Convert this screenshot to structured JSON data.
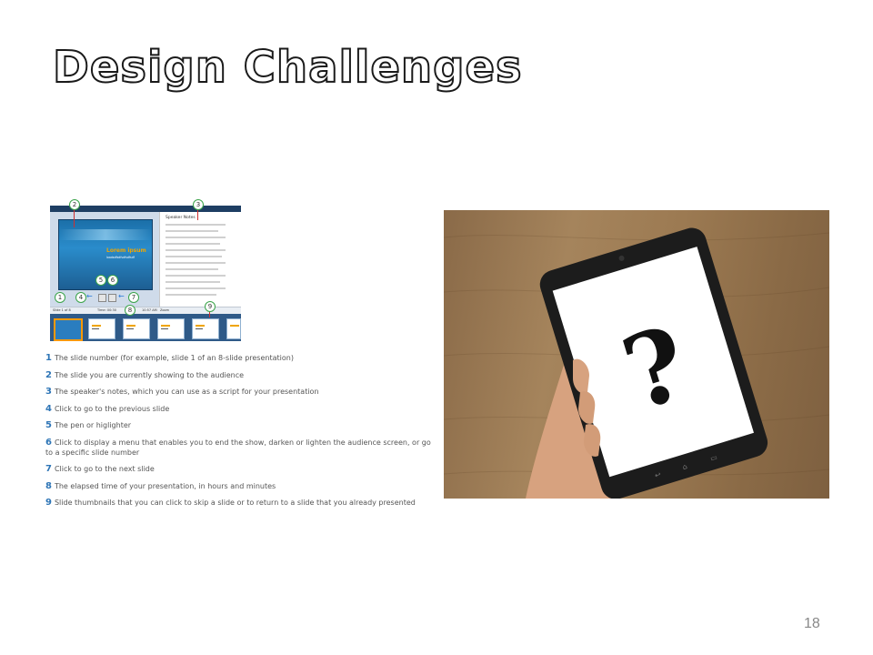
{
  "slide": {
    "title": "Design Challenges",
    "page_number": "18"
  },
  "presenter_view": {
    "lorem_title": "Lorem ipsum",
    "lorem_subtitle": "loadsdfsdfsdfsdfsdf",
    "speaker_notes_label": "Speaker Notes",
    "status_slide": "Slide 1 of 8",
    "status_time": "Time: 00:30",
    "status_clock": "10:57 AM",
    "status_zoom": "Zoom",
    "callouts": [
      "1",
      "2",
      "3",
      "4",
      "5",
      "6",
      "7",
      "8",
      "9"
    ]
  },
  "legend": [
    {
      "num": "1",
      "text": "The slide number (for example, slide 1 of an 8-slide presentation)"
    },
    {
      "num": "2",
      "text": "The slide you are currently showing to the audience"
    },
    {
      "num": "3",
      "text": "The speaker's notes, which you can use as a script for your presentation"
    },
    {
      "num": "4",
      "text": "Click to go to the previous slide"
    },
    {
      "num": "5",
      "text": "The pen or higlighter"
    },
    {
      "num": "6",
      "text": "Click to display a menu that enables you to end the show, darken or lighten the audience screen, or go to a specific slide number"
    },
    {
      "num": "7",
      "text": "Click to go to the next slide"
    },
    {
      "num": "8",
      "text": "The elapsed time of your presentation, in hours and minutes"
    },
    {
      "num": "9",
      "text": "Slide thumbnails that you can click to skip a slide or to return to a slide that you already presented"
    }
  ],
  "photo": {
    "screen_symbol": "?"
  },
  "colors": {
    "legend_number": "#2e75b6",
    "callout_border": "#3aa34a",
    "thumbstrip": "#2f5a88"
  }
}
